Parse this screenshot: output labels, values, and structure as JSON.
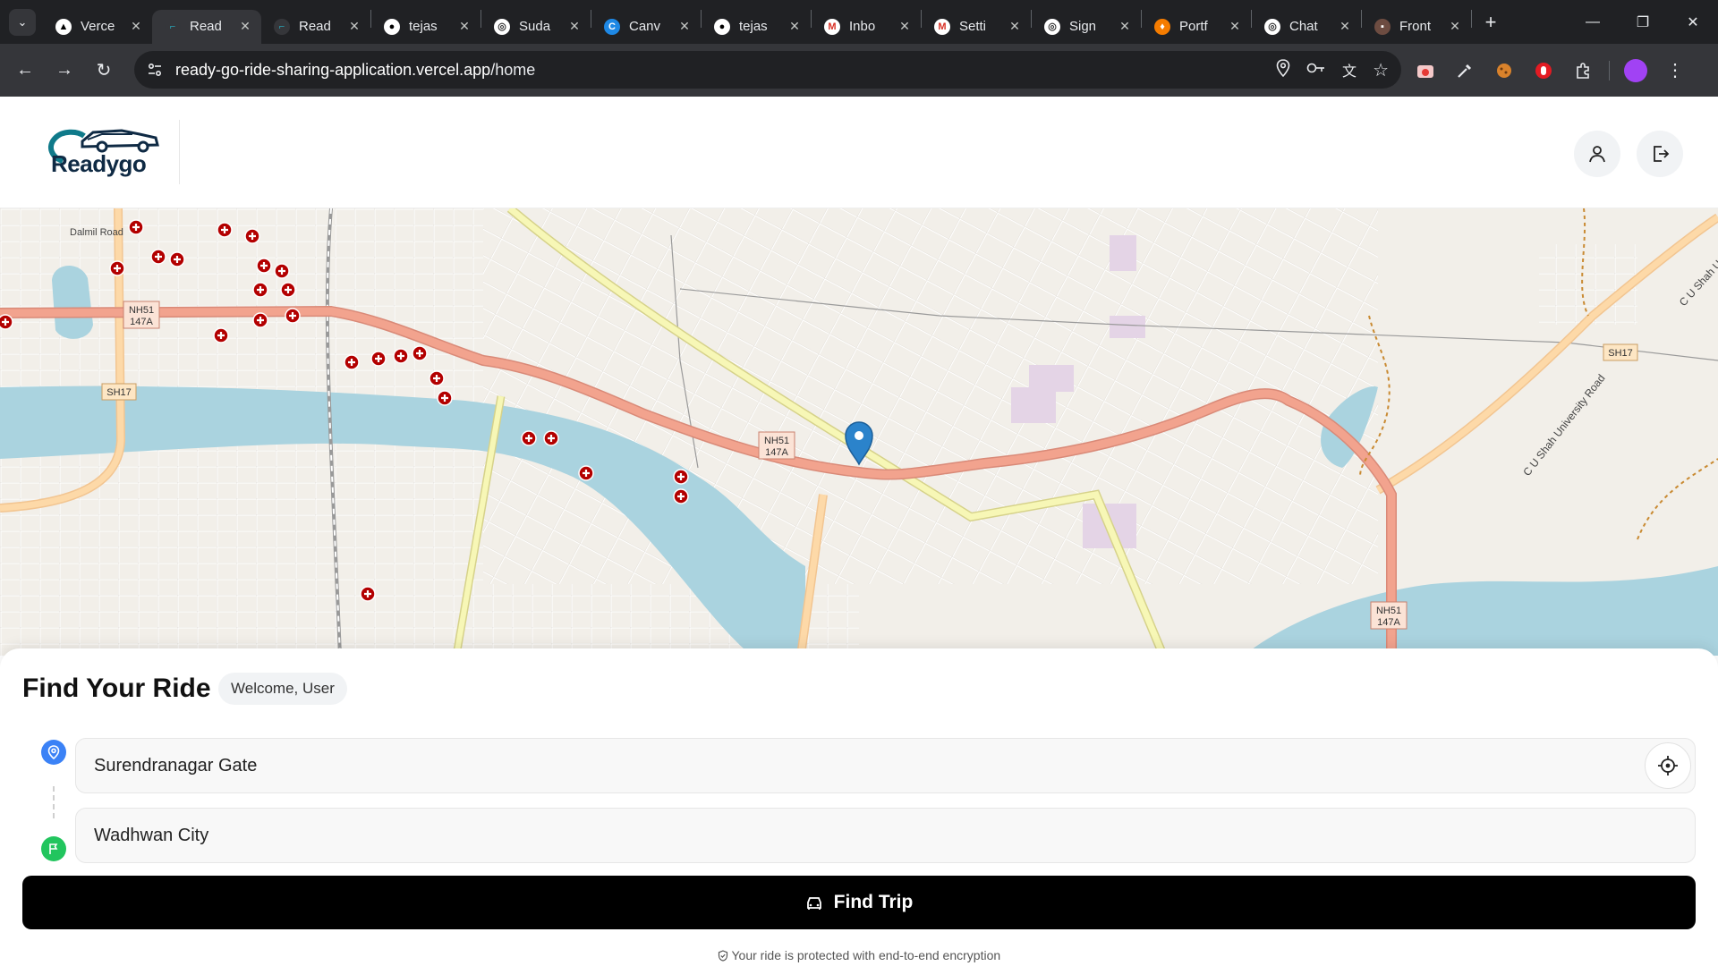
{
  "browser": {
    "tabs": [
      {
        "title": "Verce",
        "active": false
      },
      {
        "title": "Read",
        "active": true
      },
      {
        "title": "Read",
        "active": false
      },
      {
        "title": "tejas",
        "active": false
      },
      {
        "title": "Suda",
        "active": false
      },
      {
        "title": "Canv",
        "active": false
      },
      {
        "title": "tejas",
        "active": false
      },
      {
        "title": "Inbo",
        "active": false
      },
      {
        "title": "Setti",
        "active": false
      },
      {
        "title": "Sign",
        "active": false
      },
      {
        "title": "Portf",
        "active": false
      },
      {
        "title": "Chat",
        "active": false
      },
      {
        "title": "Front",
        "active": false
      }
    ],
    "url_host": "ready-go-ride-sharing-application.vercel.app",
    "url_path": "/home"
  },
  "app": {
    "logo_text": "Readygo"
  },
  "map": {
    "labels": {
      "dalmil": "Dalmil Road",
      "nh_top1": "NH51",
      "nh_top2": "147A",
      "sh17_left": "SH17",
      "nh_mid1": "NH51",
      "nh_mid2": "147A",
      "nh_right1": "NH51",
      "nh_right2": "147A",
      "sh17_right": "SH17",
      "cu_shah": "C U Shah University Road",
      "cu_shah_top": "C U Shah U"
    },
    "colors": {
      "land": "#f2efe9",
      "water": "#aad3df",
      "highway": "#f2a38e",
      "primary": "#fdd9a8",
      "secondary": "#f7f7b6",
      "hospital": "#b30000",
      "marker": "#2b83cb"
    }
  },
  "panel": {
    "title": "Find Your Ride",
    "welcome": "Welcome, User",
    "pickup_value": "Surendranagar Gate",
    "destination_value": "Wadhwan City",
    "find_button": "Find Trip",
    "secure_note": "Your ride is protected with end-to-end encryption"
  }
}
